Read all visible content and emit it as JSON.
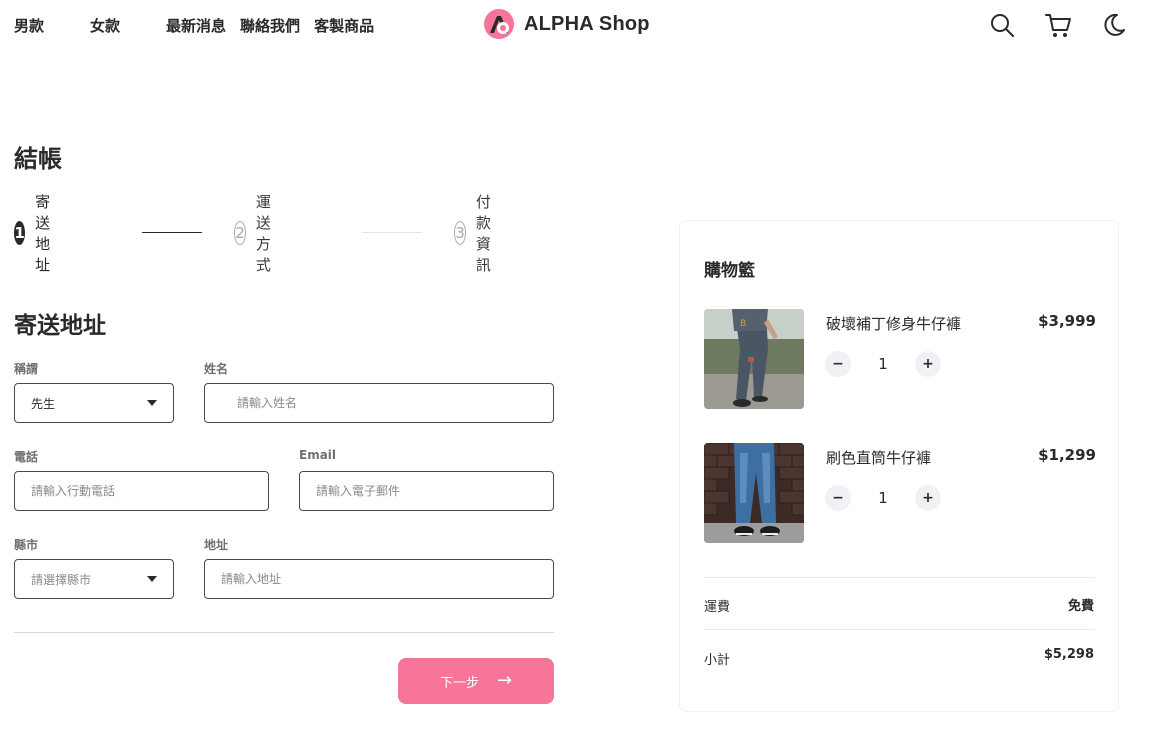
{
  "nav": {
    "links": [
      "男款",
      "女款",
      "最新消息",
      "聯絡我們",
      "客製商品"
    ],
    "brand": "ALPHA Shop",
    "icons": [
      "search-icon",
      "cart-icon",
      "moon-icon"
    ],
    "brand_color": "#f67599"
  },
  "checkout": {
    "title": "結帳",
    "steps": [
      {
        "number": "1",
        "label": "寄送地址",
        "state": "active"
      },
      {
        "number": "2",
        "label": "運送方式",
        "state": "inactive"
      },
      {
        "number": "3",
        "label": "付款資訊",
        "state": "inactive"
      }
    ]
  },
  "form": {
    "section_title": "寄送地址",
    "salutation": {
      "label": "稱謂",
      "value": "先生"
    },
    "name": {
      "label": "姓名",
      "placeholder": "請輸入姓名"
    },
    "phone": {
      "label": "電話",
      "placeholder": "請輸入行動電話"
    },
    "email": {
      "label": "Email",
      "placeholder": "請輸入電子郵件"
    },
    "county": {
      "label": "縣市",
      "placeholder": "請選擇縣市"
    },
    "address": {
      "label": "地址",
      "placeholder": "請輸入地址"
    },
    "next_label": "下一步",
    "next_arrow": "→"
  },
  "cart": {
    "title": "購物籃",
    "items": [
      {
        "name": "破壞補丁修身牛仔褲",
        "price": "$3,999",
        "quantity": "1"
      },
      {
        "name": "刷色直筒牛仔褲",
        "price": "$1,299",
        "quantity": "1"
      }
    ],
    "minus": "−",
    "plus": "+",
    "shipping_label": "運費",
    "shipping_value": "免費",
    "subtotal_label": "小計",
    "subtotal_value": "$5,298"
  }
}
